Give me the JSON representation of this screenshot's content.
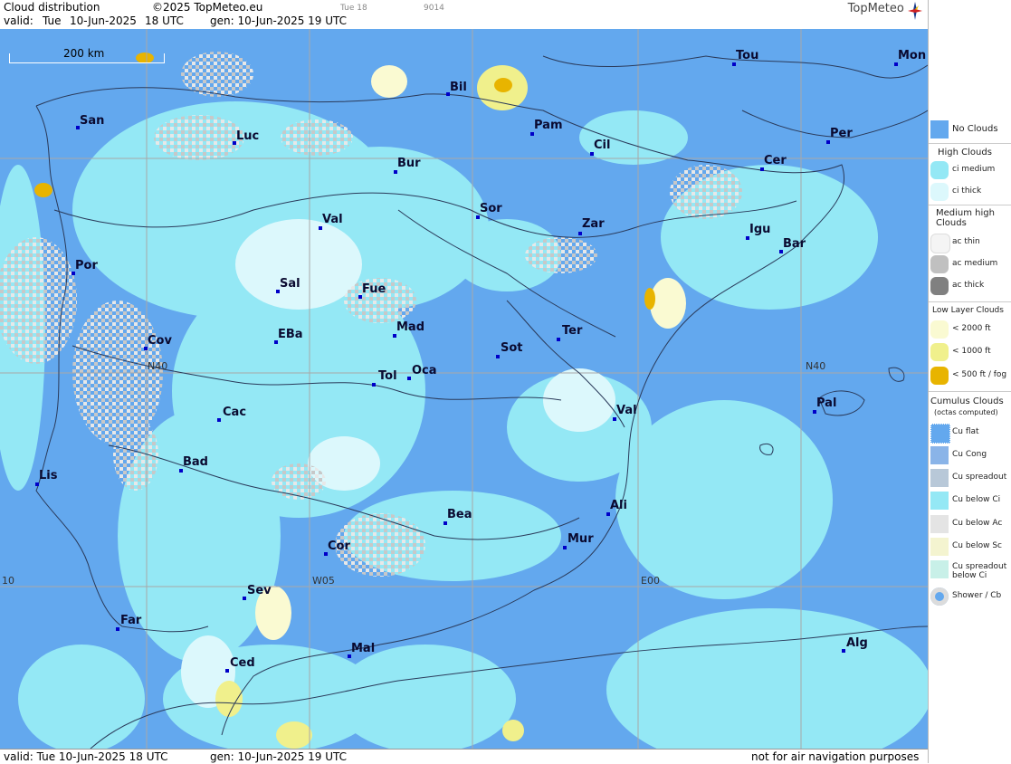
{
  "header": {
    "title": "Cloud distribution",
    "copyright": "©2025 TopMeteo.eu",
    "valid_label": "valid:",
    "valid_day": "Tue",
    "valid_date": "10-Jun-2025",
    "valid_time": "18 UTC",
    "gen_label": "gen: 10-Jun-2025 19 UTC",
    "small_code1": "Tue 18",
    "small_code2": "9014",
    "logo": "TopMeteo"
  },
  "footer": {
    "valid": "valid:  Tue  10-Jun-2025  18 UTC",
    "gen": "gen: 10-Jun-2025 19 UTC",
    "disclaimer": "not for air navigation purposes"
  },
  "map": {
    "scale_label": "200 km",
    "grid_labels": {
      "n40_left": "N40",
      "n40_right": "N40",
      "w05": "W05",
      "e00": "E00",
      "w10": "10"
    },
    "cities": [
      {
        "name": "San"
      },
      {
        "name": "Luc"
      },
      {
        "name": "Bil"
      },
      {
        "name": "Pam"
      },
      {
        "name": "Cil"
      },
      {
        "name": "Tou"
      },
      {
        "name": "Mon"
      },
      {
        "name": "Per"
      },
      {
        "name": "Cer"
      },
      {
        "name": "Bur"
      },
      {
        "name": "Sor"
      },
      {
        "name": "Zar"
      },
      {
        "name": "Val"
      },
      {
        "name": "Igu"
      },
      {
        "name": "Bar"
      },
      {
        "name": "Por"
      },
      {
        "name": "Sal"
      },
      {
        "name": "Fue"
      },
      {
        "name": "Mad"
      },
      {
        "name": "EBa"
      },
      {
        "name": "Cov"
      },
      {
        "name": "Ter"
      },
      {
        "name": "Sot"
      },
      {
        "name": "Tol"
      },
      {
        "name": "Oca"
      },
      {
        "name": "Cac"
      },
      {
        "name": "Val"
      },
      {
        "name": "Pal"
      },
      {
        "name": "Bad"
      },
      {
        "name": "Lis"
      },
      {
        "name": "Ali"
      },
      {
        "name": "Bea"
      },
      {
        "name": "Mur"
      },
      {
        "name": "Cor"
      },
      {
        "name": "Sev"
      },
      {
        "name": "Far"
      },
      {
        "name": "Mal"
      },
      {
        "name": "Alg"
      },
      {
        "name": "Ced"
      }
    ]
  },
  "legend": {
    "no_clouds": "No Clouds",
    "high_clouds": "High Clouds",
    "ci_medium": "ci medium",
    "ci_thick": "ci thick",
    "medium_high": "Medium high Clouds",
    "ac_thin": "ac thin",
    "ac_medium": "ac medium",
    "ac_thick": "ac thick",
    "low_layer": "Low Layer Clouds",
    "lt2000": "< 2000 ft",
    "lt1000": "< 1000 ft",
    "lt500": "< 500 ft / fog",
    "cumulus": "Cumulus Clouds",
    "cumulus_sub": "(octas computed)",
    "cu_flat": "Cu flat",
    "cu_cong": "Cu Cong",
    "cu_spreadout": "Cu spreadout",
    "cu_below_ci": "Cu below Ci",
    "cu_below_ac": "Cu below Ac",
    "cu_below_sc": "Cu below Sc",
    "cu_spreadout_below_ci": "Cu spreadout below Ci",
    "shower_cb": "Shower / Cb",
    "colors": {
      "no_clouds": "#63a8ee",
      "ci_medium": "#94e8f5",
      "ci_thick": "#dcf8fc",
      "ac_thin": "#f4f4f4",
      "ac_medium": "#c0c0c0",
      "ac_thick": "#808080",
      "lt2000": "#fafad2",
      "lt1000": "#f0f08c",
      "lt500": "#e8b400"
    }
  }
}
